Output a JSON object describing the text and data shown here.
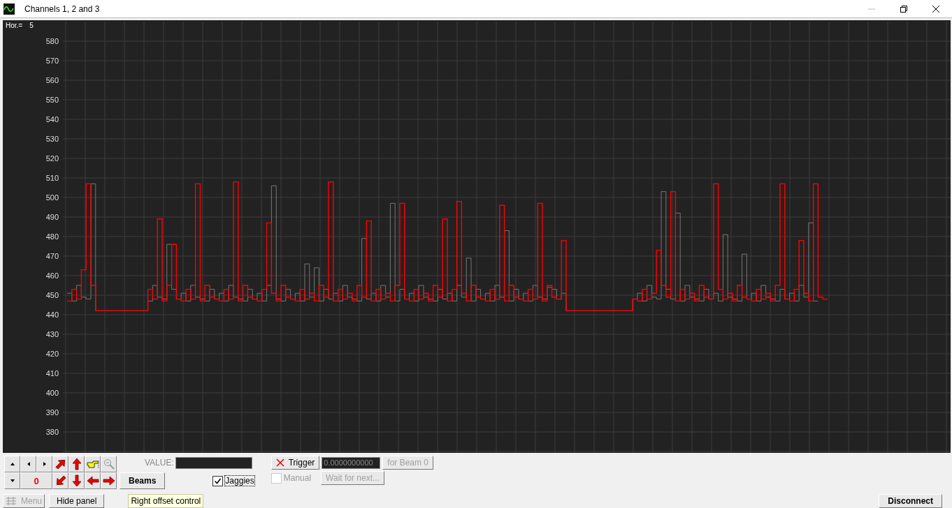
{
  "window": {
    "title": "Channels 1, 2 and 3"
  },
  "scope": {
    "hor_label": "Hor.=",
    "hor_value": "5",
    "y_labels": [
      "580",
      "570",
      "560",
      "550",
      "540",
      "530",
      "520",
      "510",
      "500",
      "490",
      "480",
      "470",
      "460",
      "450",
      "440",
      "430",
      "420",
      "410",
      "400",
      "390",
      "380"
    ]
  },
  "panel": {
    "counter": "0",
    "value_label": "VALUE:",
    "beams_button": "Beams",
    "jaggies": {
      "label": "Jaggies",
      "checked": true
    },
    "trigger_button": "Trigger",
    "trigger_value": "0.0000000000",
    "for_beam_button": {
      "label": "for Beam 0",
      "disabled": true
    },
    "manual": {
      "label": "Manual",
      "checked": false,
      "disabled": true
    },
    "wait_button": {
      "label": "Wait for next...",
      "disabled": true
    }
  },
  "footer": {
    "menu_button": {
      "label": "Menu",
      "disabled": true
    },
    "hide_panel_button": "Hide panel",
    "tooltip": "Right offset control",
    "disconnect_button": "Disconnect"
  }
}
